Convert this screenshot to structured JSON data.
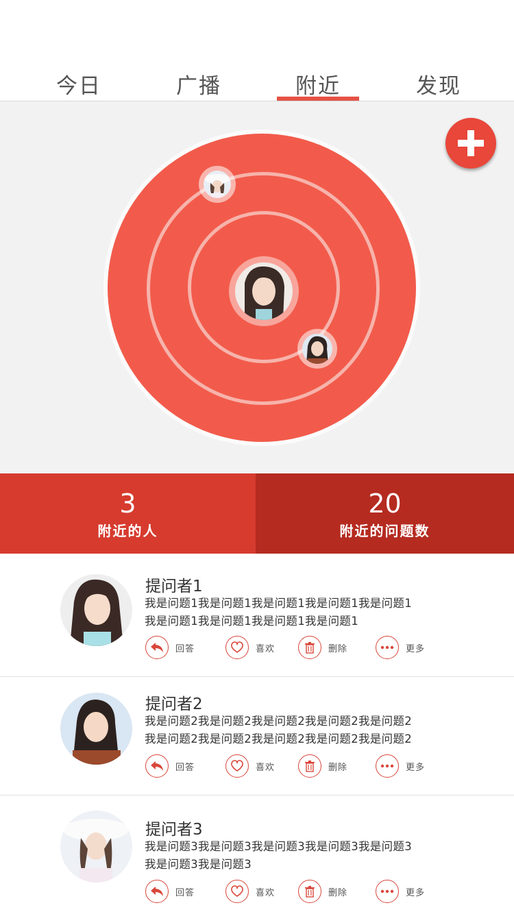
{
  "tabs": [
    {
      "label": "今日",
      "active": false
    },
    {
      "label": "广播",
      "active": false
    },
    {
      "label": "附近",
      "active": true
    },
    {
      "label": "发现",
      "active": false
    }
  ],
  "radar": {
    "add_button_icon": "plus-icon",
    "center_user": "avatar-center",
    "nearby_users": [
      "avatar-user-top",
      "avatar-user-bottom"
    ]
  },
  "stats": {
    "people_count": "3",
    "people_label": "附近的人",
    "questions_count": "20",
    "questions_label": "附近的问题数"
  },
  "actions": {
    "reply": "回答",
    "like": "喜欢",
    "delete": "删除",
    "more": "更多"
  },
  "questions": [
    {
      "asker": "提问者1",
      "line1": "我是问题1我是问题1我是问题1我是问题1我是问题1",
      "line2": "我是问题1我是问题1我是问题1我是问题1"
    },
    {
      "asker": "提问者2",
      "line1": "我是问题2我是问题2我是问题2我是问题2我是问题2",
      "line2": "我是问题2我是问题2我是问题2我是问题2我是问题2"
    },
    {
      "asker": "提问者3",
      "line1": "我是问题3我是问题3我是问题3我是问题3我是问题3",
      "line2": "我是问题3我是问题3"
    }
  ],
  "colors": {
    "accent": "#e55245",
    "radar": "#f25b4b",
    "stat_left": "#d63b2e",
    "stat_right": "#b52b20"
  }
}
